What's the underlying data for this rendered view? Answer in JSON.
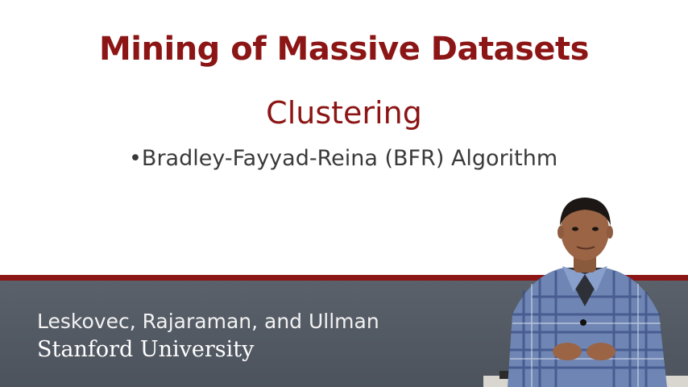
{
  "slide": {
    "title": "Mining of Massive Datasets",
    "subtitle": "Clustering",
    "bullet": "•Bradley-Fayyad-Reina (BFR) Algorithm"
  },
  "footer": {
    "authors": "Leskovec, Rajaraman, and Ullman",
    "university": "Stanford University"
  },
  "colors": {
    "accent": "#8c1515",
    "footer_bg": "#525962",
    "bullet_text": "#3a3a3a"
  }
}
